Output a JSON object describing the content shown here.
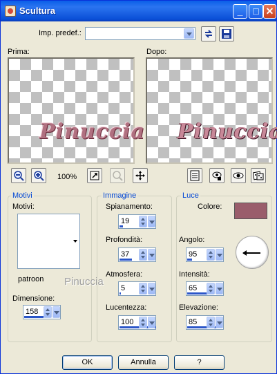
{
  "window": {
    "title": "Scultura"
  },
  "preset": {
    "label": "Imp. predef.:",
    "value": ""
  },
  "previews": {
    "before_label": "Prima:",
    "after_label": "Dopo:",
    "signature": "Pinuccia"
  },
  "zoom": {
    "level": "100%"
  },
  "motivi": {
    "group_title": "Motivi",
    "field_label": "Motivi:",
    "pattern_name": "patroon",
    "size_label": "Dimensione:",
    "size_value": "158"
  },
  "watermark": "Pinuccia",
  "immagine": {
    "group_title": "Immagine",
    "smoothness_label": "Spianamento:",
    "smoothness_value": "19",
    "depth_label": "Profondità:",
    "depth_value": "37",
    "ambience_label": "Atmosfera:",
    "ambience_value": "5",
    "shininess_label": "Lucentezza:",
    "shininess_value": "100"
  },
  "luce": {
    "group_title": "Luce",
    "color_label": "Colore:",
    "color": "#9a5d6b",
    "angle_label": "Angolo:",
    "angle_value": "95",
    "intensity_label": "Intensità:",
    "intensity_value": "65",
    "elevation_label": "Elevazione:",
    "elevation_value": "85"
  },
  "buttons": {
    "ok": "OK",
    "cancel": "Annulla",
    "help": "?"
  }
}
